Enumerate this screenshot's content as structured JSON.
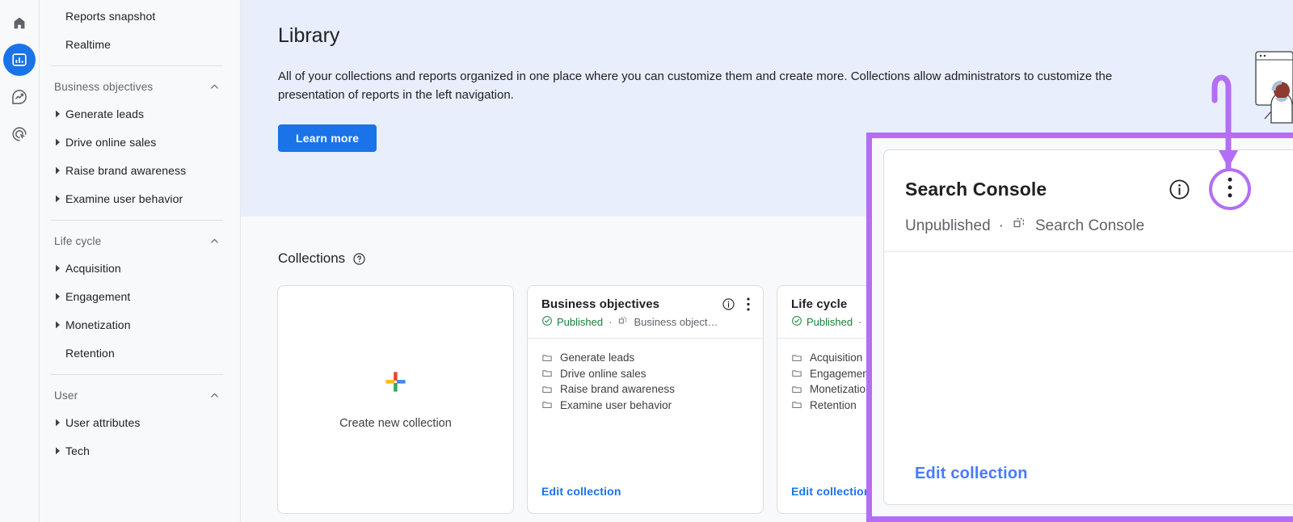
{
  "rail": {
    "items": [
      {
        "name": "home-icon",
        "label": "Home",
        "active": false
      },
      {
        "name": "reports-icon",
        "label": "Reports",
        "active": true
      },
      {
        "name": "explore-icon",
        "label": "Explore",
        "active": false
      },
      {
        "name": "advertising-icon",
        "label": "Advertising",
        "active": false
      }
    ]
  },
  "sidebar": {
    "top_items": [
      {
        "label": "Reports snapshot"
      },
      {
        "label": "Realtime"
      }
    ],
    "groups": [
      {
        "label": "Business objectives",
        "expanded": true,
        "items": [
          {
            "label": "Generate leads",
            "expandable": true
          },
          {
            "label": "Drive online sales",
            "expandable": true
          },
          {
            "label": "Raise brand awareness",
            "expandable": true
          },
          {
            "label": "Examine user behavior",
            "expandable": true
          }
        ]
      },
      {
        "label": "Life cycle",
        "expanded": true,
        "items": [
          {
            "label": "Acquisition",
            "expandable": true
          },
          {
            "label": "Engagement",
            "expandable": true
          },
          {
            "label": "Monetization",
            "expandable": true
          },
          {
            "label": "Retention",
            "expandable": false
          }
        ]
      },
      {
        "label": "User",
        "expanded": true,
        "items": [
          {
            "label": "User attributes",
            "expandable": true
          },
          {
            "label": "Tech",
            "expandable": true
          }
        ]
      }
    ]
  },
  "banner": {
    "title": "Library",
    "description": "All of your collections and reports organized in one place where you can customize them and create more. Collections allow administrators to customize the presentation of reports in the left navigation.",
    "learn_more_label": "Learn more",
    "background_color": "#e8eefc",
    "button_color": "#1a73e8"
  },
  "collections": {
    "heading": "Collections",
    "help_icon": "help-circle-icon",
    "create_card": {
      "label": "Create new collection",
      "icon": "plus-icon"
    },
    "cards": [
      {
        "title": "Business objectives",
        "status": "Published",
        "status_color": "#188038",
        "separator": "·",
        "source": "Business object…",
        "info_icon": "info-icon",
        "menu_icon": "kebab-menu-icon",
        "items": [
          "Generate leads",
          "Drive online sales",
          "Raise brand awareness",
          "Examine user behavior"
        ],
        "edit_label": "Edit collection"
      },
      {
        "title": "Life cycle",
        "status": "Published",
        "status_color": "#188038",
        "separator": "·",
        "source": "",
        "info_icon": "info-icon",
        "menu_icon": "kebab-menu-icon",
        "items": [
          "Acquisition",
          "Engagement",
          "Monetization",
          "Retention"
        ],
        "edit_label": "Edit collection"
      }
    ]
  },
  "overlay": {
    "highlight_color": "#b36ef5",
    "card": {
      "title": "Search Console",
      "status": "Unpublished",
      "separator": "·",
      "source": "Search Console",
      "info_icon": "info-icon",
      "menu_icon": "kebab-menu-icon",
      "edit_label": "Edit collection"
    }
  }
}
